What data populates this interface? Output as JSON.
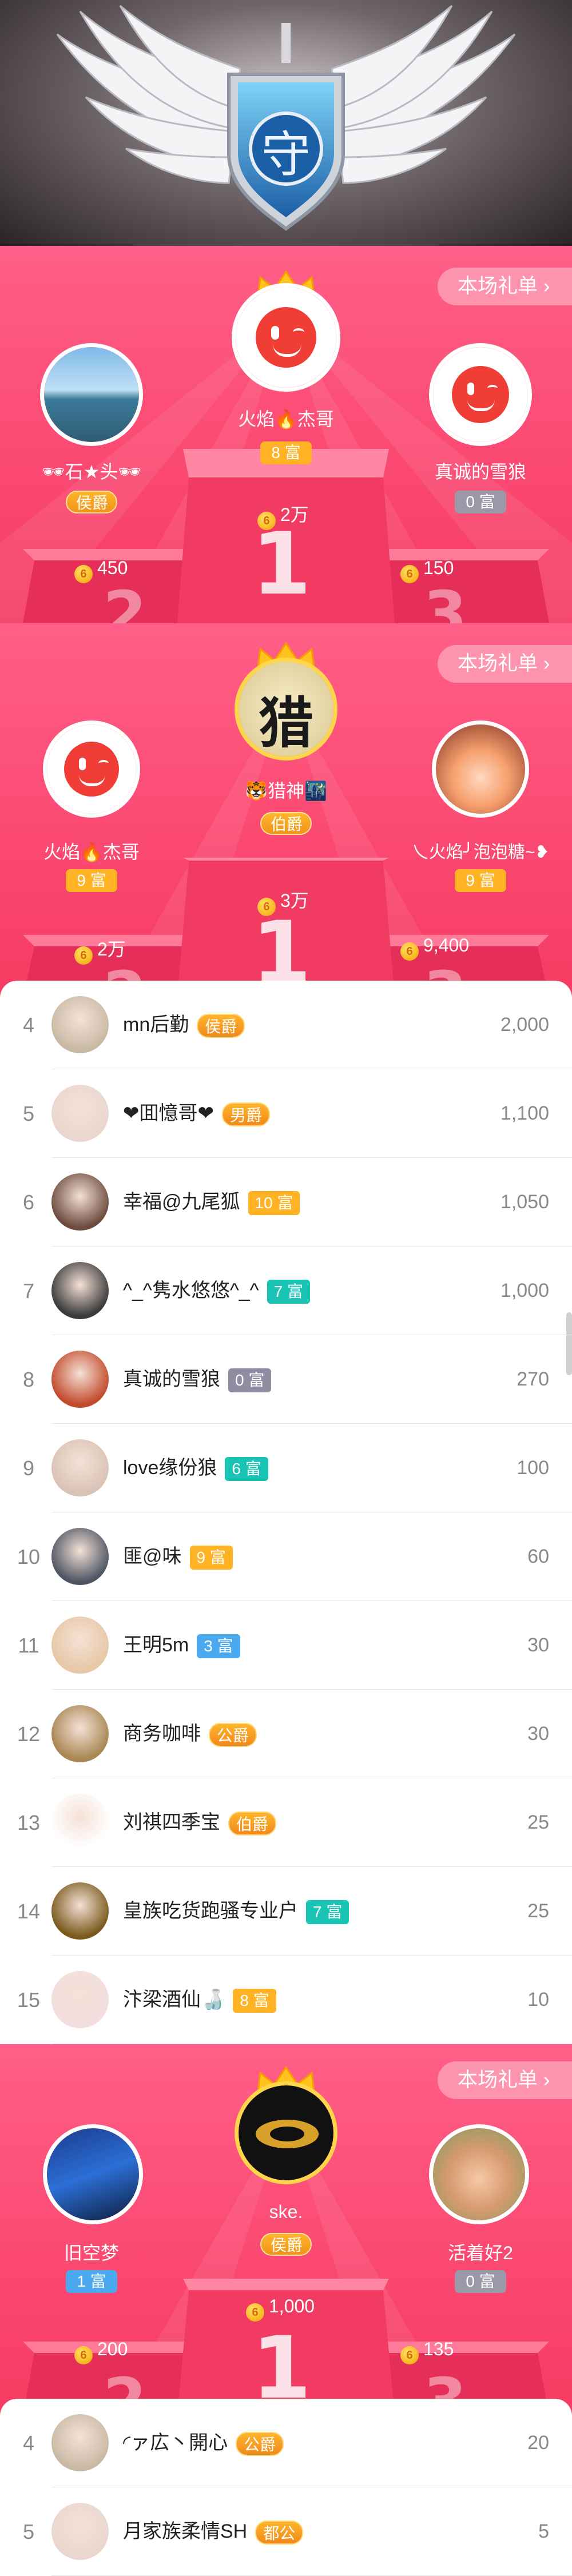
{
  "banner": {
    "emblem_char": "守"
  },
  "podium1": {
    "gift_label": "本场礼单 ›",
    "first": {
      "name": "火焰🔥杰哥",
      "badge": "8 富",
      "amount": "2万",
      "rank_digit": "1"
    },
    "second": {
      "name": "🕶石★头🕶",
      "badge": "侯爵",
      "amount": "450",
      "rank_digit": "2"
    },
    "third": {
      "name": "真诚的雪狼",
      "badge": "0 富",
      "amount": "150",
      "rank_digit": "3"
    }
  },
  "podium2": {
    "gift_label": "本场礼单 ›",
    "first": {
      "name": "🐯猎神🌃",
      "badge": "伯爵",
      "amount": "3万",
      "avatar_char": "猎",
      "rank_digit": "1"
    },
    "second": {
      "name": "火焰🔥杰哥",
      "badge": "9 富",
      "amount": "2万",
      "rank_digit": "2"
    },
    "third": {
      "name": "乀火焰╯泡泡糖~❥",
      "badge": "9 富",
      "amount": "9,400",
      "rank_digit": "3"
    }
  },
  "list1": [
    {
      "rank": "4",
      "name": "mn后勤",
      "badge": "侯爵",
      "badge_type": "noble",
      "value": "2,000"
    },
    {
      "rank": "5",
      "name": "❤囬憶哥❤",
      "badge": "男爵",
      "badge_type": "noble",
      "value": "1,100"
    },
    {
      "rank": "6",
      "name": "幸福@九尾狐",
      "badge": "10 富",
      "badge_type": "gold",
      "value": "1,050"
    },
    {
      "rank": "7",
      "name": "^_^隽水悠悠^_^",
      "badge": "7 富",
      "badge_type": "teal",
      "value": "1,000"
    },
    {
      "rank": "8",
      "name": "真诚的雪狼",
      "badge": "0 富",
      "badge_type": "gray",
      "value": "270"
    },
    {
      "rank": "9",
      "name": "love缘份狼",
      "badge": "6 富",
      "badge_type": "teal",
      "value": "100"
    },
    {
      "rank": "10",
      "name": "匪@味",
      "badge": "9 富",
      "badge_type": "gold",
      "value": "60"
    },
    {
      "rank": "11",
      "name": "王明5m",
      "badge": "3 富",
      "badge_type": "blue",
      "value": "30"
    },
    {
      "rank": "12",
      "name": "商务咖啡",
      "badge": "公爵",
      "badge_type": "noble",
      "value": "30"
    },
    {
      "rank": "13",
      "name": "刘祺四季宝",
      "badge": "伯爵",
      "badge_type": "noble",
      "value": "25"
    },
    {
      "rank": "14",
      "name": "皇族吃货跑骚专业户",
      "badge": "7 富",
      "badge_type": "teal",
      "value": "25"
    },
    {
      "rank": "15",
      "name": "汴梁酒仙🍶",
      "badge": "8 富",
      "badge_type": "gold",
      "value": "10"
    }
  ],
  "podium3": {
    "gift_label": "本场礼单 ›",
    "first": {
      "name": "ske.",
      "badge": "侯爵",
      "amount": "1,000",
      "rank_digit": "1"
    },
    "second": {
      "name": "旧空梦",
      "badge": "1 富",
      "amount": "200",
      "rank_digit": "2"
    },
    "third": {
      "name": "活着好2",
      "badge": "0 富",
      "amount": "135",
      "rank_digit": "3"
    }
  },
  "list2": [
    {
      "rank": "4",
      "name": "◜ァ広丶開心",
      "badge": "公爵",
      "badge_type": "noble",
      "value": "20"
    },
    {
      "rank": "5",
      "name": "月家族柔情SH",
      "badge": "都公",
      "badge_type": "noble",
      "value": "5"
    }
  ],
  "colors": {
    "accent_pink": "#fb4a72",
    "gold": "#ffb324",
    "teal": "#19c4b4",
    "gray_badge": "#908da2",
    "blue_badge": "#4aa9ef"
  },
  "icons": [
    "crown-icon",
    "coin-icon",
    "chevron-right-icon",
    "wing-icon",
    "shield-icon"
  ]
}
